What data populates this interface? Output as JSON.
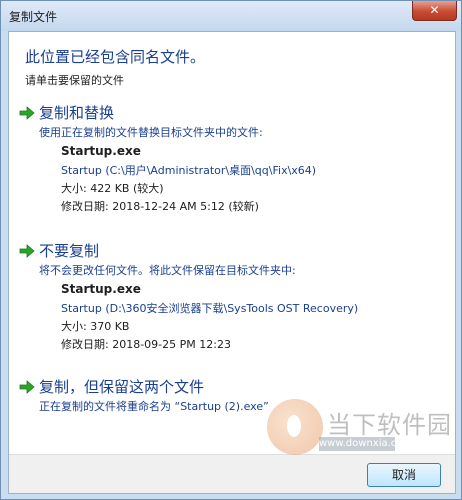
{
  "window": {
    "title": "复制文件",
    "close_label": "✕"
  },
  "dialog": {
    "heading": "此位置已经包含同名文件。",
    "subheading": "请单击要保留的文件"
  },
  "options": [
    {
      "title": "复制和替换",
      "description": "使用正在复制的文件替换目标文件夹中的文件:",
      "file_name": "Startup.exe",
      "file_path": "Startup (C:\\用户\\Administrator\\桌面\\qq\\Fix\\x64)",
      "size": "大小: 422 KB (较大)",
      "modified": "修改日期: 2018-12-24 AM 5:12 (较新)"
    },
    {
      "title": "不要复制",
      "description": "将不会更改任何文件。将此文件保留在目标文件夹中:",
      "file_name": "Startup.exe",
      "file_path": "Startup (D:\\360安全浏览器下载\\SysTools OST Recovery)",
      "size": "大小: 370 KB",
      "modified": "修改日期: 2018-09-25 PM 12:23"
    },
    {
      "title": "复制，但保留这两个文件",
      "description": "正在复制的文件将重命名为 “Startup (2).exe”"
    }
  ],
  "footer": {
    "cancel_label": "取消"
  },
  "watermark": {
    "text": "当下软件园",
    "url": "www.downxia.com"
  },
  "colors": {
    "accent_blue": "#1a3f8f",
    "arrow_green": "#2aa52a",
    "close_red": "#c84b33"
  },
  "icons": {
    "option_arrow": "green-right-arrow-icon",
    "close": "close-icon"
  }
}
